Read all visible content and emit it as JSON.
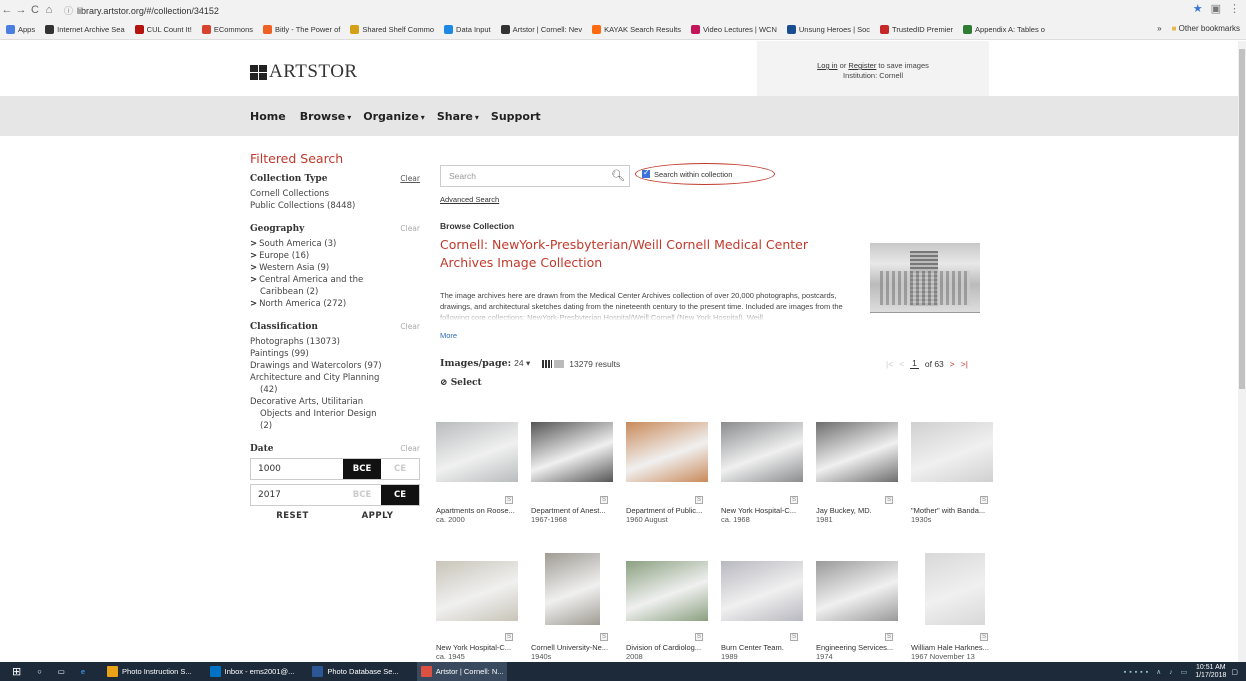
{
  "browser": {
    "url": "library.artstor.org/#/collection/34152",
    "bookmarks": [
      {
        "label": "Apps",
        "color": "#4a7ee0"
      },
      {
        "label": "Internet Archive Sea",
        "color": "#333333"
      },
      {
        "label": "CUL Count It!",
        "color": "#b3120e"
      },
      {
        "label": "ECommons",
        "color": "#d6422d"
      },
      {
        "label": "Bitly - The Power of",
        "color": "#ee6123"
      },
      {
        "label": "Shared Shelf Commo",
        "color": "#d4a017"
      },
      {
        "label": "Data Input",
        "color": "#1e88e5"
      },
      {
        "label": "Artstor | Cornell: Nev",
        "color": "#333333"
      },
      {
        "label": "KAYAK Search Results",
        "color": "#ff690f"
      },
      {
        "label": "Video Lectures | WCN",
        "color": "#c2185b"
      },
      {
        "label": "Unsung Heroes | Soc",
        "color": "#1a4d8f"
      },
      {
        "label": "TrustedID Premier",
        "color": "#c62828"
      },
      {
        "label": "Appendix A: Tables o",
        "color": "#2e7d32"
      }
    ],
    "bookmarks_more": "»",
    "other_bookmarks": "Other bookmarks"
  },
  "header": {
    "logo_text": "ARTSTOR",
    "login_link": "Log in",
    "login_or": " or ",
    "register_link": "Register",
    "login_suffix": " to save images",
    "institution": "Institution: Cornell"
  },
  "nav": [
    {
      "label": "Home",
      "caret": ""
    },
    {
      "label": "Browse",
      "caret": "▾"
    },
    {
      "label": "Organize",
      "caret": "▾"
    },
    {
      "label": "Share",
      "caret": "▾"
    },
    {
      "label": "Support",
      "caret": ""
    }
  ],
  "sidebar": {
    "title": "Filtered Search",
    "clear": "Clear",
    "collection_type": {
      "heading": "Collection Type",
      "items": [
        "Cornell Collections",
        "Public Collections (8448)"
      ]
    },
    "geography": {
      "heading": "Geography",
      "items": [
        "South America (3)",
        "Europe (16)",
        "Western Asia (9)",
        "Central America and the",
        "Caribbean (2)",
        "North America (272)"
      ]
    },
    "classification": {
      "heading": "Classification",
      "items": [
        "Photographs (13073)",
        "Paintings (99)",
        "Drawings and Watercolors (97)",
        "Architecture and City Planning",
        "(42)",
        "Decorative Arts, Utilitarian",
        "Objects and Interior Design",
        "(2)"
      ]
    },
    "date": {
      "heading": "Date",
      "start": "1000",
      "end": "2017",
      "bce": "BCE",
      "ce": "CE",
      "reset": "RESET",
      "apply": "APPLY"
    }
  },
  "search": {
    "placeholder": "Search",
    "within_label": "Search within collection",
    "advanced": "Advanced Search"
  },
  "collection": {
    "browse_heading": "Browse Collection",
    "title": "Cornell: NewYork-Presbyterian/Weill Cornell Medical Center Archives Image Collection",
    "description": "The image archives here are drawn from the Medical Center Archives collection of over 20,000 photographs, postcards, drawings, and architectural sketches dating from the nineteenth century to the present time. Included are images from the following core collections: NewYork-Presbyterian Hospital/Weill Cornell (New York Hospital), Weill",
    "more": "More"
  },
  "results": {
    "images_per_page_label": "Images/page:",
    "images_per_page": "24 ▾",
    "count": "13279 results",
    "page": "1",
    "of_pages": "of 63",
    "select": "Select"
  },
  "thumbnails": [
    {
      "title": "Apartments on Roose...",
      "date": "ca. 2000",
      "tone": "#b9bcbd"
    },
    {
      "title": "Department of Anest...",
      "date": "1967-1968",
      "tone": "#555555"
    },
    {
      "title": "Department of Public...",
      "date": "1960 August",
      "tone": "#c98a5a"
    },
    {
      "title": "New York Hospital-C...",
      "date": "ca. 1968",
      "tone": "#8a8c8e"
    },
    {
      "title": "Jay Buckey, MD.",
      "date": "1981",
      "tone": "#6e6e6e"
    },
    {
      "title": "\"Mother\" with Banda...",
      "date": "1930s",
      "tone": "#d0d0d0"
    },
    {
      "title": "New York Hospital-C...",
      "date": "ca. 1945",
      "tone": "#c8c4b8"
    },
    {
      "title": "Cornell University-Ne...",
      "date": "1940s",
      "tone": "#a09c94"
    },
    {
      "title": "Division of Cardiolog...",
      "date": "2008",
      "tone": "#8aa080"
    },
    {
      "title": "Burn Center Team.",
      "date": "1989",
      "tone": "#b8b8c0"
    },
    {
      "title": "Engineering Services...",
      "date": "1974",
      "tone": "#9a9a9a"
    },
    {
      "title": "William Hale Harknes...",
      "date": "1967 November 13",
      "tone": "#d8d8d8"
    }
  ],
  "taskbar": {
    "items": [
      {
        "label": "Photo Instruction S...",
        "color": "#e8a317"
      },
      {
        "label": "Inbox - ems2001@...",
        "color": "#0072c6"
      },
      {
        "label": "Photo Database Se...",
        "color": "#2b5797"
      },
      {
        "label": "Artstor | Cornell: N...",
        "color": "#dd5044"
      }
    ],
    "time": "10:51 AM",
    "date": "1/17/2018"
  }
}
